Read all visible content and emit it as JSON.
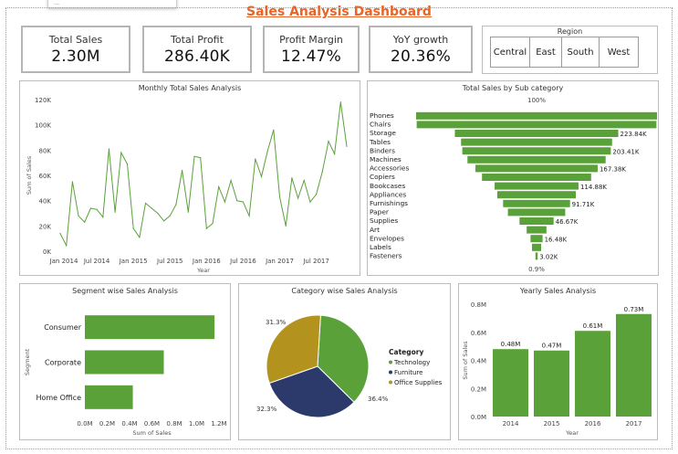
{
  "dashboard_title": "Sales Analysis Dashboard",
  "kpis": [
    {
      "label": "Total Sales",
      "value": "2.30M"
    },
    {
      "label": "Total Profit",
      "value": "286.40K"
    },
    {
      "label": "Profit Margin",
      "value": "12.47%"
    },
    {
      "label": "YoY growth",
      "value": "20.36%"
    }
  ],
  "region": {
    "title": "Region",
    "options": [
      "Central",
      "East",
      "South",
      "West"
    ]
  },
  "colors": {
    "green": "#5aa13a",
    "navy": "#2b3a6b",
    "gold": "#b3921e",
    "title": "#e8652a"
  },
  "chart_data": [
    {
      "type": "line",
      "title": "Monthly Total Sales Analysis",
      "xlabel": "Year",
      "ylabel": "Sum of Sales",
      "ylim": [
        0,
        120000
      ],
      "y_ticks": [
        "0K",
        "20K",
        "40K",
        "60K",
        "80K",
        "100K",
        "120K"
      ],
      "x_ticks": [
        "Jan 2014",
        "Jul 2014",
        "Jan 2015",
        "Jul 2015",
        "Jan 2016",
        "Jul 2016",
        "Jan 2017",
        "Jul 2017"
      ],
      "values": [
        14000,
        4500,
        55000,
        28000,
        23000,
        34000,
        33000,
        27000,
        81000,
        31000,
        78000,
        69000,
        18000,
        11000,
        38000,
        34000,
        30000,
        24000,
        28000,
        37000,
        64000,
        31000,
        75000,
        74000,
        18000,
        22000,
        51000,
        39000,
        56000,
        40000,
        39000,
        28000,
        73000,
        59000,
        79000,
        96000,
        43000,
        20000,
        58000,
        42000,
        56000,
        39000,
        45000,
        63000,
        87000,
        77000,
        118000,
        83000
      ]
    },
    {
      "type": "bar",
      "title": "Total Sales by Sub category",
      "top_label": "100%",
      "bottom_label": "0.9%",
      "categories": [
        "Phones",
        "Chairs",
        "Storage",
        "Tables",
        "Binders",
        "Machines",
        "Accessories",
        "Copiers",
        "Bookcases",
        "Appliances",
        "Furnishings",
        "Paper",
        "Supplies",
        "Art",
        "Envelopes",
        "Labels",
        "Fasteners"
      ],
      "values": [
        330010,
        328450,
        223840,
        206970,
        203410,
        189240,
        167380,
        149530,
        114880,
        107530,
        91710,
        78480,
        46670,
        27120,
        16480,
        12490,
        3020
      ],
      "data_labels": [
        "",
        "",
        "223.84K",
        "",
        "203.41K",
        "",
        "167.38K",
        "",
        "114.88K",
        "",
        "91.71K",
        "",
        "46.67K",
        "",
        "16.48K",
        "",
        "3.02K"
      ]
    },
    {
      "type": "bar",
      "title": "Segment wise Sales Analysis",
      "xlabel": "Sum of Sales",
      "ylabel": "Segment",
      "categories": [
        "Consumer",
        "Corporate",
        "Home Office"
      ],
      "values": [
        1160000,
        706000,
        429000
      ],
      "xlim": [
        0,
        1200000
      ],
      "x_ticks": [
        "0.0M",
        "0.2M",
        "0.4M",
        "0.6M",
        "0.8M",
        "1.0M",
        "1.2M"
      ]
    },
    {
      "type": "pie",
      "title": "Category wise Sales Analysis",
      "legend_title": "Category",
      "categories": [
        "Technology",
        "Furniture",
        "Office Supplies"
      ],
      "values": [
        36.4,
        32.3,
        31.3
      ],
      "data_labels": [
        "36.4%",
        "32.3%",
        "31.3%"
      ]
    },
    {
      "type": "bar",
      "title": "Yearly Sales Analysis",
      "xlabel": "Year",
      "ylabel": "Sum of Sales",
      "categories": [
        "2014",
        "2015",
        "2016",
        "2017"
      ],
      "values": [
        480000,
        470000,
        610000,
        730000
      ],
      "data_labels": [
        "0.48M",
        "0.47M",
        "0.61M",
        "0.73M"
      ],
      "ylim": [
        0,
        800000
      ],
      "y_ticks": [
        "0.0M",
        "0.2M",
        "0.4M",
        "0.6M",
        "0.8M"
      ]
    }
  ]
}
